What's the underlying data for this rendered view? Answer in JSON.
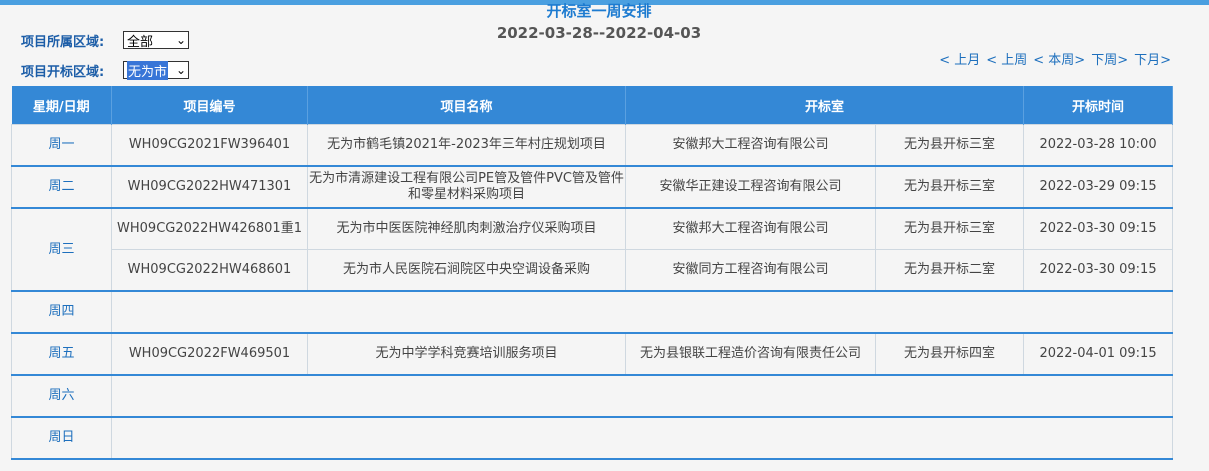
{
  "filters": {
    "region_label": "项目所属区域:",
    "region_value": "全部",
    "open_region_label": "项目开标区域:",
    "open_region_value": "无为市"
  },
  "header": {
    "title": "开标室一周安排",
    "date_range": "2022-03-28--2022-04-03"
  },
  "nav": {
    "prev_month": "< 上月",
    "prev_week": "< 上周",
    "this_week": "< 本周>",
    "next_week": "下周>",
    "next_month": "下月>"
  },
  "table": {
    "columns": [
      "星期/日期",
      "项目编号",
      "项目名称",
      "开标室",
      "开标时间"
    ],
    "rows": [
      {
        "day": "周一",
        "code": "WH09CG2021FW396401",
        "name": "无为市鹤毛镇2021年-2023年三年村庄规划项目",
        "agency": "安徽邦大工程咨询有限公司",
        "room": "无为县开标三室",
        "time": "2022-03-28 10:00"
      },
      {
        "day": "周二",
        "code": "WH09CG2022HW471301",
        "name": "无为市清源建设工程有限公司PE管及管件PVC管及管件和零星材料采购项目",
        "agency": "安徽华正建设工程咨询有限公司",
        "room": "无为县开标三室",
        "time": "2022-03-29 09:15"
      },
      {
        "day": "周三",
        "code": "WH09CG2022HW426801重1",
        "name": "无为市中医医院神经肌肉刺激治疗仪采购项目",
        "agency": "安徽邦大工程咨询有限公司",
        "room": "无为县开标三室",
        "time": "2022-03-30 09:15"
      },
      {
        "day": "",
        "code": "WH09CG2022HW468601",
        "name": "无为市人民医院石涧院区中央空调设备采购",
        "agency": "安徽同方工程咨询有限公司",
        "room": "无为县开标二室",
        "time": "2022-03-30 09:15"
      },
      {
        "day": "周四"
      },
      {
        "day": "周五",
        "code": "WH09CG2022FW469501",
        "name": "无为中学学科竞赛培训服务项目",
        "agency": "无为县银联工程造价咨询有限责任公司",
        "room": "无为县开标四室",
        "time": "2022-04-01 09:15"
      },
      {
        "day": "周六"
      },
      {
        "day": "周日"
      }
    ]
  }
}
